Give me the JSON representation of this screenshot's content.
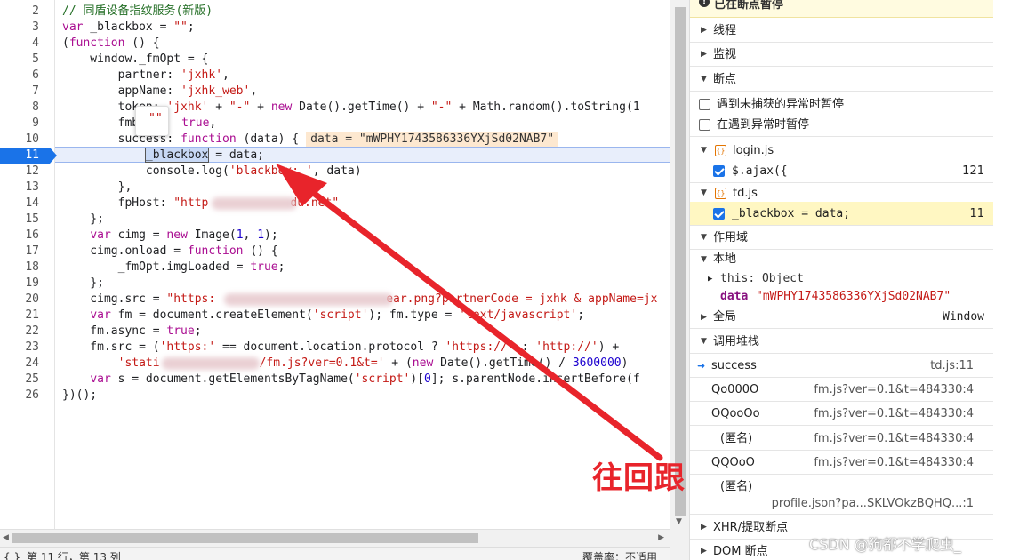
{
  "editor": {
    "line_numbers": [
      "2",
      "3",
      "4",
      "5",
      "6",
      "7",
      "8",
      "9",
      "10",
      "11",
      "12",
      "13",
      "14",
      "15",
      "16",
      "17",
      "18",
      "19",
      "20",
      "21",
      "22",
      "23",
      "24",
      "25",
      "26"
    ],
    "current_line": "11",
    "tooltip_value": "\"\"",
    "inline_value": "data = \"mWPHY1743586336YXjSd02NAB7\"",
    "lines": {
      "l2": "// 同盾设备指纹服务(新版)",
      "l3a": "var",
      "l3b": " _blackbox = ",
      "l3c": "\"\"",
      "l3d": ";",
      "l4a": "(",
      "l4b": "function",
      "l4c": " () {",
      "l5": "    window._fmOpt = {",
      "l6a": "        partner: ",
      "l6b": "'jxhk'",
      "l6c": ",",
      "l7a": "        appName: ",
      "l7b": "'jxhk_web'",
      "l7c": ",",
      "l8a": "        tok",
      "l8b": "en: ",
      "l8c": "'jxhk'",
      "l8d": " + ",
      "l8e": "\"-\"",
      "l8f": " + ",
      "l8g": "new",
      "l8h": " Date().getTime() + ",
      "l8i": "\"-\"",
      "l8j": " + Math.random().toString(1",
      "l9a": "        fmb",
      "l9b": "true",
      "l9c": ",",
      "l10a": "        success: ",
      "l10b": "function",
      "l10c": " (data) {",
      "l11a": "            ",
      "l11b": "_blackbox",
      "l11c": " = data;",
      "l12a": "            console.log(",
      "l12b": "'blac",
      "l12c": "kbox: '",
      "l12d": ", data)",
      "l13": "        },",
      "l14a": "        fpHost: ",
      "l14b": "\"http",
      "l14c": "du.net\"",
      "l15": "    };",
      "l16a": "    ",
      "l16b": "var",
      "l16c": " cimg = ",
      "l16d": "new",
      "l16e": " Image(",
      "l16f": "1",
      "l16g": ", ",
      "l16h": "1",
      "l16i": ");",
      "l17a": "    cimg.onload = ",
      "l17b": "function",
      "l17c": " () {",
      "l18a": "        _fmOpt.imgLoaded = ",
      "l18b": "true",
      "l18c": ";",
      "l19": "    };",
      "l20a": "    cimg.src = ",
      "l20b": "\"https:",
      "l20c": "ear.png?partnerCode = jxhk & appName=jx",
      "l21a": "    ",
      "l21b": "var",
      "l21c": " fm = document.createElement(",
      "l21d": "'script'",
      "l21e": "); fm.type = ",
      "l21f": "'text/javascript'",
      "l21g": ";",
      "l22a": "    fm.async = ",
      "l22b": "true",
      "l22c": ";",
      "l23a": "    fm.src = (",
      "l23b": "'https:'",
      "l23c": " == document.location.protocol ? ",
      "l23d": "'https://'",
      "l23e": " : ",
      "l23f": "'http://'",
      "l23g": ") +",
      "l24a": "        ",
      "l24b": "'stati",
      "l24c": "/fm.js?ver=0.1&t='",
      "l24d": " + (",
      "l24e": "new",
      "l24f": " Date().getTime() / ",
      "l24g": "3600000",
      "l24h": ")",
      "l25a": "    ",
      "l25b": "var",
      "l25c": " s = document.getElementsByTagName(",
      "l25d": "'script'",
      "l25e": ")[",
      "l25f": "0",
      "l25g": "]; s.parentNode.insertBefore(f",
      "l26": "})();"
    }
  },
  "statusbar": {
    "left_icon": "{ }",
    "position": "第 11 行，第 13 列",
    "right1": "覆盖率：不适用"
  },
  "debugger": {
    "paused_label": "已在断点暂停",
    "threads": "线程",
    "watch": "监视",
    "breakpoints": "断点",
    "pause_uncaught": "遇到未捕获的异常时暂停",
    "pause_caught": "在遇到异常时暂停",
    "file1": "login.js",
    "file1_bp_code": "$.ajax({",
    "file1_bp_line": "121",
    "file2": "td.js",
    "file2_bp_code": "_blackbox = data;",
    "file2_bp_line": "11",
    "scope": "作用域",
    "local": "本地",
    "this_key": "this",
    "this_val": "Object",
    "data_key": "data",
    "data_val": "\"mWPHY1743586336YXjSd02NAB7\"",
    "global": "全局",
    "global_val": "Window",
    "call_stack": "调用堆栈",
    "frames": [
      {
        "fn": "success",
        "loc": "td.js:11"
      },
      {
        "fn": "Qo000O",
        "loc": "fm.js?ver=0.1&t=484330:4"
      },
      {
        "fn": "OQooOo",
        "loc": "fm.js?ver=0.1&t=484330:4"
      },
      {
        "fn": "(匿名)",
        "loc": "fm.js?ver=0.1&t=484330:4"
      },
      {
        "fn": "QQOoO",
        "loc": "fm.js?ver=0.1&t=484330:4"
      },
      {
        "fn": "(匿名)",
        "loc": "profile.json?pa...SKLVOkzBQHQ...:1"
      }
    ],
    "xhr_breakpoints": "XHR/提取断点",
    "dom_breakpoints": "DOM 断点"
  },
  "annotation": {
    "text": "往回跟",
    "color": "#e8242b"
  },
  "watermark": "CSDN @狗都不学爬虫_"
}
